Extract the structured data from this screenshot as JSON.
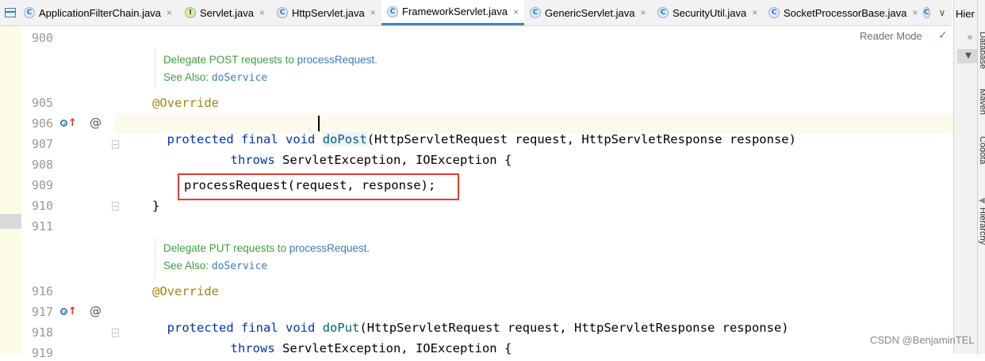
{
  "tabs": [
    {
      "label": "ApplicationFilterChain.java",
      "icon": "class-icon",
      "active": false
    },
    {
      "label": "Servlet.java",
      "icon": "interface-icon",
      "active": false
    },
    {
      "label": "HttpServlet.java",
      "icon": "class-icon",
      "active": false
    },
    {
      "label": "FrameworkServlet.java",
      "icon": "class-icon",
      "active": true
    },
    {
      "label": "GenericServlet.java",
      "icon": "class-icon",
      "active": false
    },
    {
      "label": "SecurityUtil.java",
      "icon": "class-icon",
      "active": false
    },
    {
      "label": "SocketProcessorBase.java",
      "icon": "class-icon",
      "active": false
    }
  ],
  "tab_close_glyph": "×",
  "tab_overflow_glyph": "∨",
  "reader_mode": "Reader Mode",
  "right_panel": {
    "title": "Hier",
    "chevron": "»",
    "side_labels": [
      "Database",
      "Maven",
      "Codota",
      "Hierarchy"
    ]
  },
  "gutter": {
    "line_numbers": [
      "900",
      "905",
      "906",
      "907",
      "908",
      "909",
      "910",
      "911",
      "916",
      "917",
      "918",
      "919"
    ]
  },
  "doc1": {
    "text": "Delegate POST requests to ",
    "link": "processRequest",
    "suffix": ".",
    "see_also_label": "See Also:",
    "see_also_link": "doService"
  },
  "doc2": {
    "text": "Delegate PUT requests to ",
    "link": "processRequest",
    "suffix": ".",
    "see_also_label": "See Also:",
    "see_also_link": "doService"
  },
  "code": {
    "override": "@Override",
    "kw_protected": "protected",
    "kw_final": "final",
    "kw_void": "void",
    "method_post": "doPost",
    "method_put": "doPut",
    "params": "(HttpServletRequest request, HttpServletResponse response)",
    "kw_throws": "throws",
    "exceptions": " ServletException, IOException {",
    "process_call": "processRequest(request, response);",
    "close_brace": "}"
  },
  "watermark": "CSDN @BenjaminTEL",
  "colors": {
    "keyword": "#0033b3",
    "annotation": "#9e880d",
    "method": "#00627a",
    "doc_text": "#3e9e3e",
    "highlight_box": "#e53935",
    "active_tab_underline": "#4083c9"
  }
}
